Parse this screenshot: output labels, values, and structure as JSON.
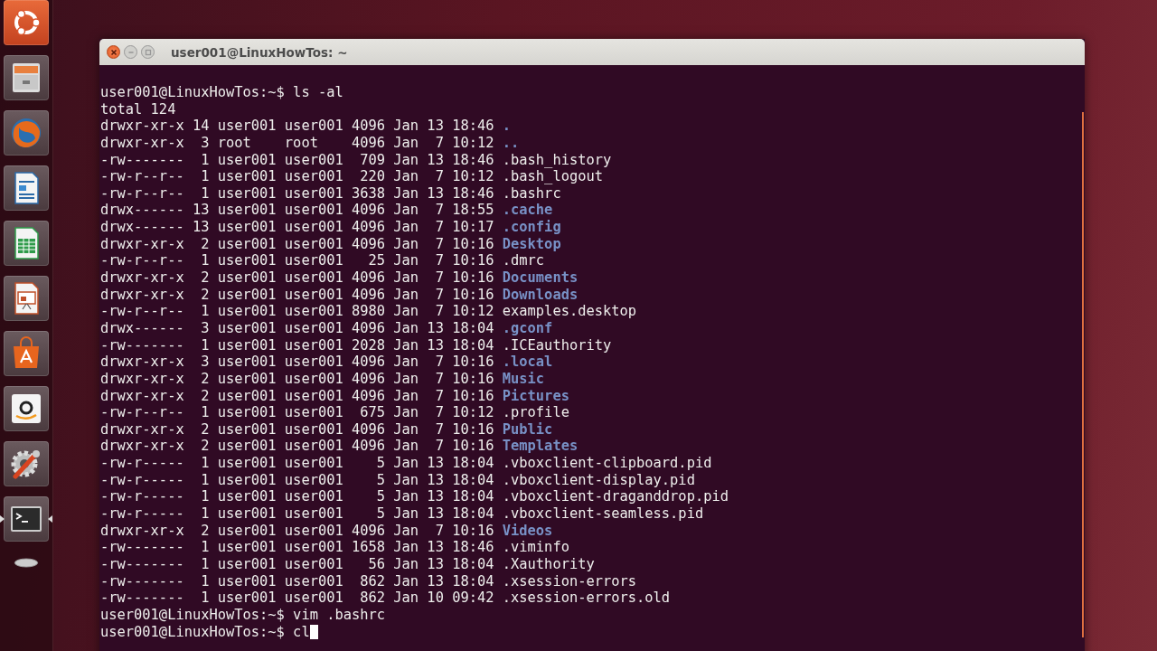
{
  "launcher": [
    {
      "kind": "dash",
      "running": false
    },
    {
      "kind": "files",
      "running": false
    },
    {
      "kind": "browser",
      "running": false
    },
    {
      "kind": "writer",
      "running": false
    },
    {
      "kind": "calc",
      "running": false
    },
    {
      "kind": "impress",
      "running": false
    },
    {
      "kind": "store",
      "running": false
    },
    {
      "kind": "amazon",
      "running": false
    },
    {
      "kind": "settings",
      "running": false
    },
    {
      "kind": "terminal",
      "running": true
    },
    {
      "kind": "trash",
      "running": false
    }
  ],
  "window": {
    "title": "user001@LinuxHowTos: ~"
  },
  "terminal": {
    "lines": [
      {
        "kind": "prompt",
        "text": "user001@LinuxHowTos:~$ ls -al"
      },
      {
        "kind": "text",
        "text": "total 124"
      },
      {
        "kind": "dir",
        "meta": "drwxr-xr-x 14 user001 user001 4096 Jan 13 18:46",
        "name": "."
      },
      {
        "kind": "dir",
        "meta": "drwxr-xr-x  3 root    root    4096 Jan  7 10:12",
        "name": ".."
      },
      {
        "kind": "file",
        "meta": "-rw-------  1 user001 user001  709 Jan 13 18:46",
        "name": ".bash_history"
      },
      {
        "kind": "file",
        "meta": "-rw-r--r--  1 user001 user001  220 Jan  7 10:12",
        "name": ".bash_logout"
      },
      {
        "kind": "file",
        "meta": "-rw-r--r--  1 user001 user001 3638 Jan 13 18:46",
        "name": ".bashrc"
      },
      {
        "kind": "dir",
        "meta": "drwx------ 13 user001 user001 4096 Jan  7 18:55",
        "name": ".cache"
      },
      {
        "kind": "dir",
        "meta": "drwx------ 13 user001 user001 4096 Jan  7 10:17",
        "name": ".config"
      },
      {
        "kind": "dir",
        "meta": "drwxr-xr-x  2 user001 user001 4096 Jan  7 10:16",
        "name": "Desktop"
      },
      {
        "kind": "file",
        "meta": "-rw-r--r--  1 user001 user001   25 Jan  7 10:16",
        "name": ".dmrc"
      },
      {
        "kind": "dir",
        "meta": "drwxr-xr-x  2 user001 user001 4096 Jan  7 10:16",
        "name": "Documents"
      },
      {
        "kind": "dir",
        "meta": "drwxr-xr-x  2 user001 user001 4096 Jan  7 10:16",
        "name": "Downloads"
      },
      {
        "kind": "file",
        "meta": "-rw-r--r--  1 user001 user001 8980 Jan  7 10:12",
        "name": "examples.desktop"
      },
      {
        "kind": "dir",
        "meta": "drwx------  3 user001 user001 4096 Jan 13 18:04",
        "name": ".gconf"
      },
      {
        "kind": "file",
        "meta": "-rw-------  1 user001 user001 2028 Jan 13 18:04",
        "name": ".ICEauthority"
      },
      {
        "kind": "dir",
        "meta": "drwxr-xr-x  3 user001 user001 4096 Jan  7 10:16",
        "name": ".local"
      },
      {
        "kind": "dir",
        "meta": "drwxr-xr-x  2 user001 user001 4096 Jan  7 10:16",
        "name": "Music"
      },
      {
        "kind": "dir",
        "meta": "drwxr-xr-x  2 user001 user001 4096 Jan  7 10:16",
        "name": "Pictures"
      },
      {
        "kind": "file",
        "meta": "-rw-r--r--  1 user001 user001  675 Jan  7 10:12",
        "name": ".profile"
      },
      {
        "kind": "dir",
        "meta": "drwxr-xr-x  2 user001 user001 4096 Jan  7 10:16",
        "name": "Public"
      },
      {
        "kind": "dir",
        "meta": "drwxr-xr-x  2 user001 user001 4096 Jan  7 10:16",
        "name": "Templates"
      },
      {
        "kind": "file",
        "meta": "-rw-r-----  1 user001 user001    5 Jan 13 18:04",
        "name": ".vboxclient-clipboard.pid"
      },
      {
        "kind": "file",
        "meta": "-rw-r-----  1 user001 user001    5 Jan 13 18:04",
        "name": ".vboxclient-display.pid"
      },
      {
        "kind": "file",
        "meta": "-rw-r-----  1 user001 user001    5 Jan 13 18:04",
        "name": ".vboxclient-draganddrop.pid"
      },
      {
        "kind": "file",
        "meta": "-rw-r-----  1 user001 user001    5 Jan 13 18:04",
        "name": ".vboxclient-seamless.pid"
      },
      {
        "kind": "dir",
        "meta": "drwxr-xr-x  2 user001 user001 4096 Jan  7 10:16",
        "name": "Videos"
      },
      {
        "kind": "file",
        "meta": "-rw-------  1 user001 user001 1658 Jan 13 18:46",
        "name": ".viminfo"
      },
      {
        "kind": "file",
        "meta": "-rw-------  1 user001 user001   56 Jan 13 18:04",
        "name": ".Xauthority"
      },
      {
        "kind": "file",
        "meta": "-rw-------  1 user001 user001  862 Jan 13 18:04",
        "name": ".xsession-errors"
      },
      {
        "kind": "file",
        "meta": "-rw-------  1 user001 user001  862 Jan 10 09:42",
        "name": ".xsession-errors.old"
      },
      {
        "kind": "prompt",
        "text": "user001@LinuxHowTos:~$ vim .bashrc"
      },
      {
        "kind": "input",
        "text": "user001@LinuxHowTos:~$ cl"
      }
    ]
  }
}
